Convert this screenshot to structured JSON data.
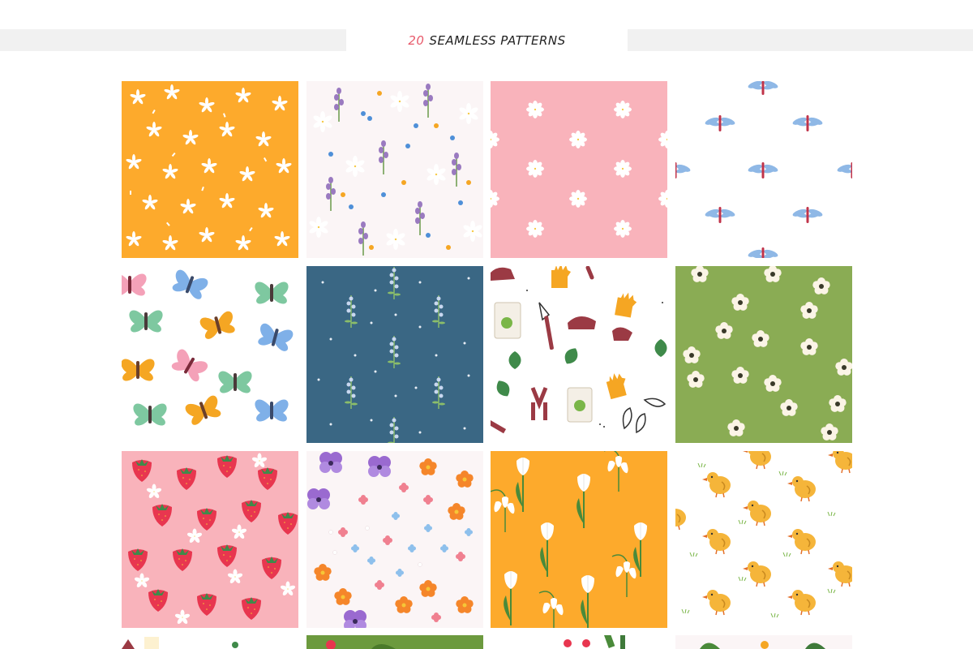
{
  "header": {
    "count": "20",
    "title": "SEAMLESS PATTERNS"
  },
  "colors": {
    "orange": "#fdaa2c",
    "pink": "#f9b3bb",
    "blue": "#3a6784",
    "green": "#8aac54",
    "white": "#ffffff",
    "paper": "#fbf5f6"
  },
  "tiles": [
    {
      "pattern": "white-daisies-on-orange"
    },
    {
      "pattern": "wildflowers-lavender"
    },
    {
      "pattern": "daisies-on-pink"
    },
    {
      "pattern": "dragonflies-on-white"
    },
    {
      "pattern": "butterflies-on-white"
    },
    {
      "pattern": "lavender-sprigs-on-blue"
    },
    {
      "pattern": "garden-tools-on-white"
    },
    {
      "pattern": "white-flowers-on-green"
    },
    {
      "pattern": "strawberries-on-pink"
    },
    {
      "pattern": "pansies-and-blossoms"
    },
    {
      "pattern": "snowdrops-on-orange"
    },
    {
      "pattern": "chicks-on-white"
    },
    {
      "pattern": "partial-row-1"
    },
    {
      "pattern": "partial-row-2"
    },
    {
      "pattern": "partial-row-3"
    },
    {
      "pattern": "partial-row-4"
    }
  ]
}
